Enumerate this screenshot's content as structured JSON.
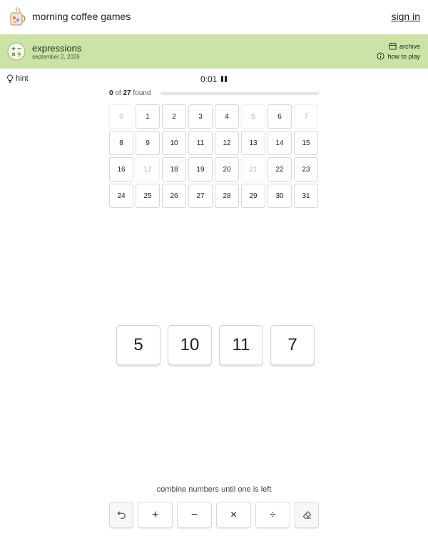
{
  "header": {
    "app_title": "morning coffee games",
    "sign_in": "sign in"
  },
  "game": {
    "name": "expressions",
    "date": "september 2, 2026",
    "archive": "archive",
    "how_to_play": "how to play"
  },
  "hint": "hint",
  "timer": "0:01",
  "progress": {
    "found": "0",
    "of_label": "of",
    "total": "27",
    "found_label": "found",
    "fraction": 0
  },
  "grid": [
    {
      "n": "0",
      "missing": true
    },
    {
      "n": "1",
      "missing": false
    },
    {
      "n": "2",
      "missing": false
    },
    {
      "n": "3",
      "missing": false
    },
    {
      "n": "4",
      "missing": false
    },
    {
      "n": "5",
      "missing": true
    },
    {
      "n": "6",
      "missing": false
    },
    {
      "n": "7",
      "missing": true
    },
    {
      "n": "8",
      "missing": false
    },
    {
      "n": "9",
      "missing": false
    },
    {
      "n": "10",
      "missing": false
    },
    {
      "n": "11",
      "missing": false
    },
    {
      "n": "12",
      "missing": false
    },
    {
      "n": "13",
      "missing": false
    },
    {
      "n": "14",
      "missing": false
    },
    {
      "n": "15",
      "missing": false
    },
    {
      "n": "16",
      "missing": false
    },
    {
      "n": "17",
      "missing": true
    },
    {
      "n": "18",
      "missing": false
    },
    {
      "n": "19",
      "missing": false
    },
    {
      "n": "20",
      "missing": false
    },
    {
      "n": "21",
      "missing": true
    },
    {
      "n": "22",
      "missing": false
    },
    {
      "n": "23",
      "missing": false
    },
    {
      "n": "24",
      "missing": false
    },
    {
      "n": "25",
      "missing": false
    },
    {
      "n": "26",
      "missing": false
    },
    {
      "n": "27",
      "missing": false
    },
    {
      "n": "28",
      "missing": false
    },
    {
      "n": "29",
      "missing": false
    },
    {
      "n": "30",
      "missing": false
    },
    {
      "n": "31",
      "missing": false
    }
  ],
  "tiles": [
    "5",
    "10",
    "11",
    "7"
  ],
  "instructions": "combine numbers until one is left",
  "ops": {
    "add": "+",
    "subtract": "−",
    "multiply": "×",
    "divide": "÷"
  },
  "colors": {
    "band": "#cce3a8",
    "progress_fill": "#9cc56a",
    "missing_text": "#b3b3b3"
  },
  "icons": {
    "logo": "coffee-mug-icon",
    "band": "operators-icon",
    "archive": "calendar-icon",
    "how_to_play": "info-icon",
    "hint": "lightbulb-icon",
    "pause": "pause-icon",
    "undo": "undo-icon",
    "clear": "eraser-icon"
  }
}
